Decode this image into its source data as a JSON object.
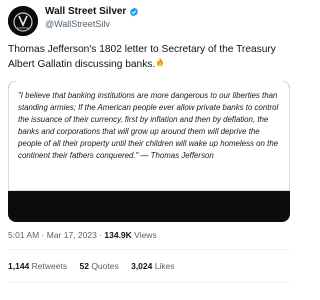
{
  "author": {
    "name": "Wall Street Silver",
    "handle": "@WallStreetSilv",
    "verified_color": "#1d9bf0"
  },
  "tweet": {
    "text": "Thomas Jefferson's 1802 letter to Secretary of the Treasury Albert Gallatin discussing banks.",
    "emoji_icon": "fire-icon"
  },
  "quote_image": {
    "text": "\"I believe that banking institutions are more dangerous to our liberties than standing armies; If the American people ever allow private banks to control the issuance of their currency, first by inflation and then by deflation, the banks and corporations that will grow up around them will deprive the people of all their property until their children will wake up homeless on the continent their fathers conquered.\" — Thomas Jefferson"
  },
  "meta": {
    "time_date": "5:01 AM · Mar 17, 2023 · ",
    "views_count": "134.9K",
    "views_label": " Views"
  },
  "stats": {
    "retweets_count": "1,144",
    "retweets_label": "Retweets",
    "quotes_count": "52",
    "quotes_label": "Quotes",
    "likes_count": "3,024",
    "likes_label": "Likes"
  }
}
